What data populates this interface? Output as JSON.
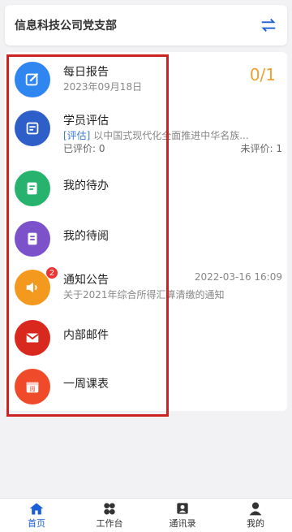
{
  "header": {
    "title": "信息科技公司党支部"
  },
  "items": [
    {
      "key": "daily-report",
      "title": "每日报告",
      "subtitle": "2023年09月18日",
      "count": "0/1",
      "color": "#2f86f0",
      "icon": "edit-icon"
    },
    {
      "key": "student-eval",
      "title": "学员评估",
      "tag": "[评估]",
      "subtitle": " 以中国式现代化全面推进中华名族...",
      "evaluated": "已评价: 0",
      "not_evaluated": "未评价: 1",
      "color": "#2e5fc8",
      "icon": "evaluation-icon"
    },
    {
      "key": "my-todo",
      "title": "我的待办",
      "color": "#27b36e",
      "icon": "todo-icon"
    },
    {
      "key": "my-read",
      "title": "我的待阅",
      "color": "#7b52c9",
      "icon": "document-icon"
    },
    {
      "key": "notice",
      "title": "通知公告",
      "time": "2022-03-16 16:09",
      "subtitle": "关于2021年综合所得汇算清缴的通知",
      "badge": "2",
      "color": "#f39a1e",
      "icon": "speaker-icon"
    },
    {
      "key": "mail",
      "title": "内部邮件",
      "color": "#d9281e",
      "icon": "mail-icon"
    },
    {
      "key": "schedule",
      "title": "一周课表",
      "color": "#ef4a2a",
      "icon": "calendar-icon",
      "icon_text": "周"
    }
  ],
  "tabs": [
    {
      "label": "首页",
      "icon": "home-icon",
      "active": true
    },
    {
      "label": "工作台",
      "icon": "workbench-icon",
      "active": false
    },
    {
      "label": "通讯录",
      "icon": "contacts-icon",
      "active": false
    },
    {
      "label": "我的",
      "icon": "profile-icon",
      "active": false
    }
  ],
  "colors": {
    "accent": "#1a5fd6",
    "count": "#f0a030",
    "highlight_border": "#cc2222"
  }
}
